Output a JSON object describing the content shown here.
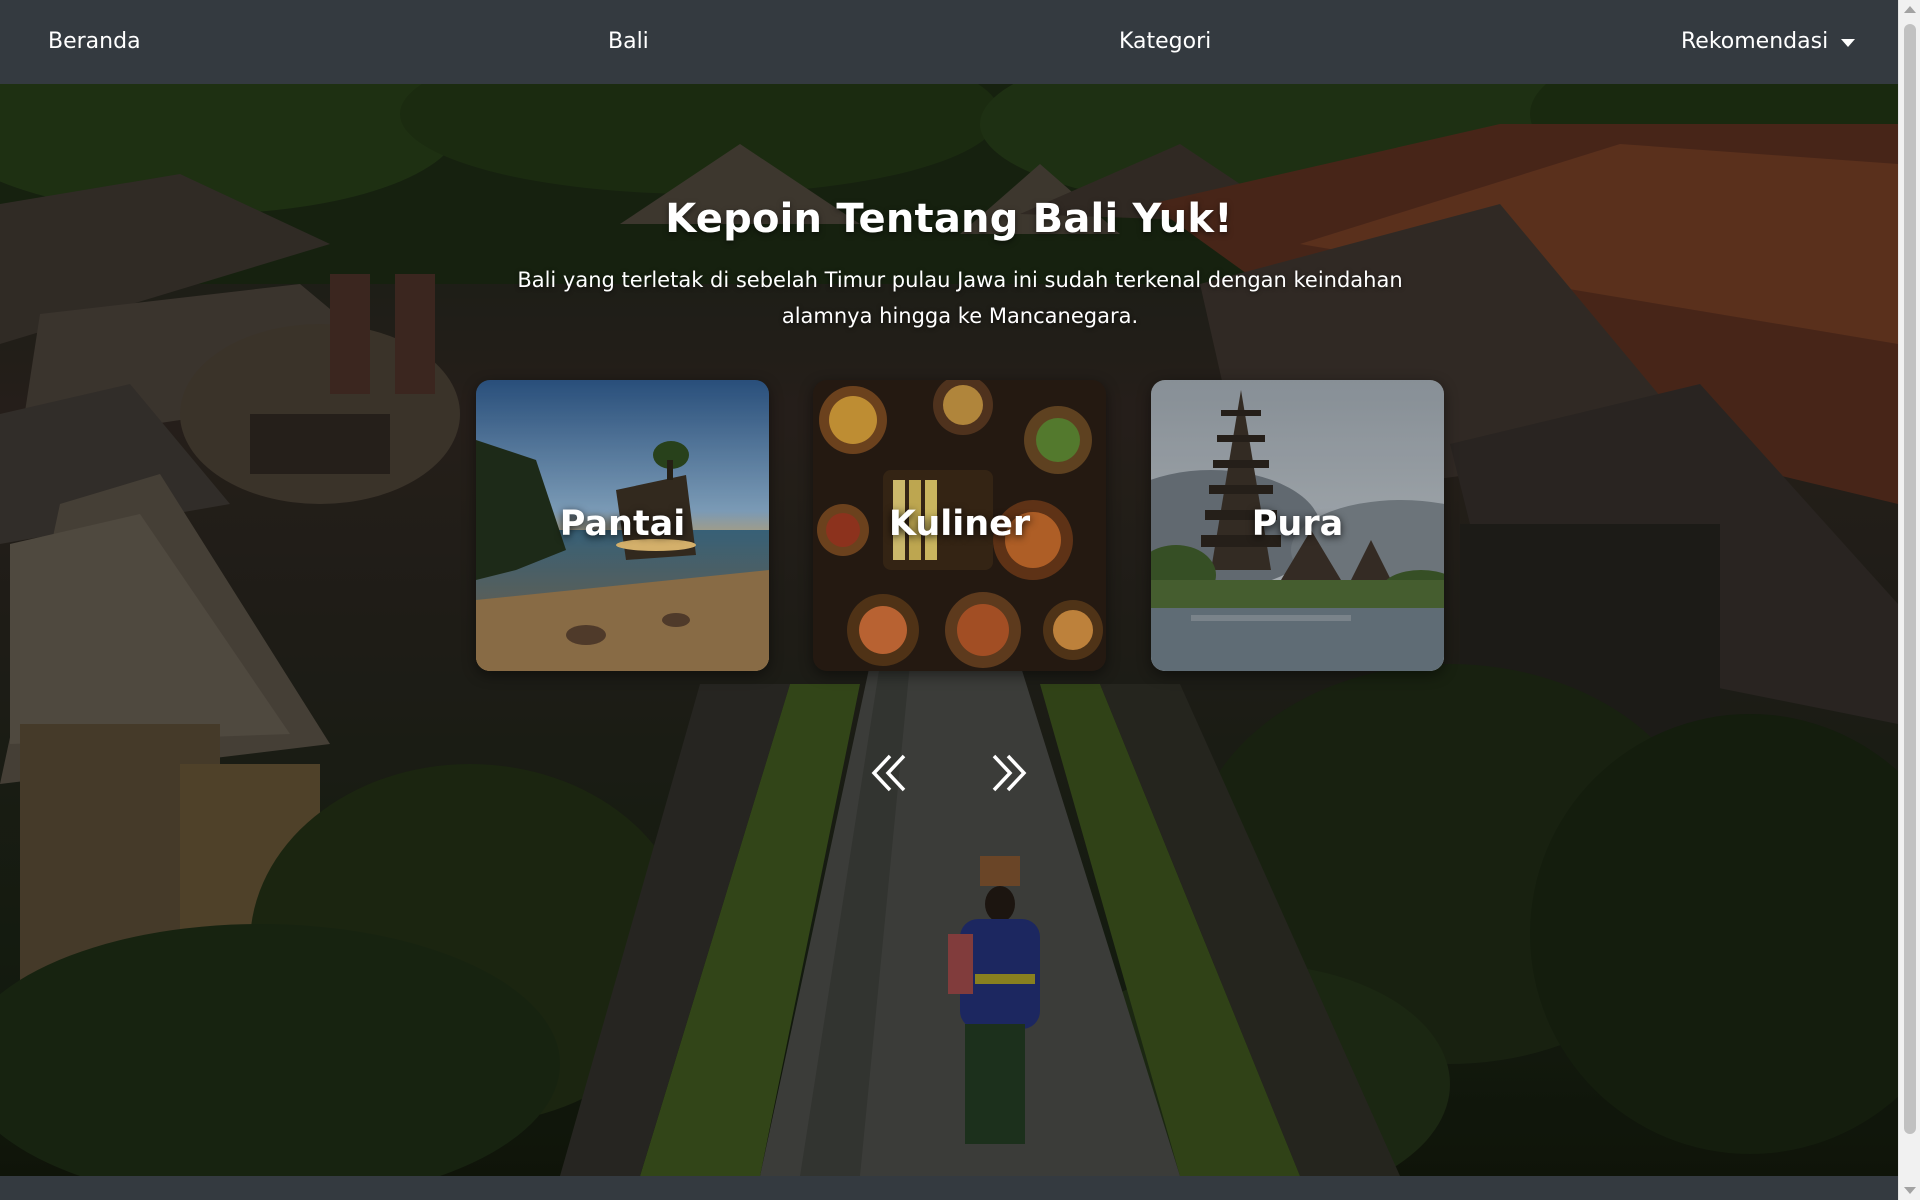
{
  "navbar": {
    "items": [
      {
        "label": "Beranda"
      },
      {
        "label": "Bali"
      },
      {
        "label": "Kategori"
      },
      {
        "label": "Rekomendasi"
      }
    ]
  },
  "hero": {
    "title": "Kepoin Tentang Bali Yuk!",
    "subtitle": "Bali yang terletak di sebelah Timur pulau Jawa ini sudah terkenal dengan keindahan alamnya hingga ke Mancanegara."
  },
  "cards": [
    {
      "label": "Pantai"
    },
    {
      "label": "Kuliner"
    },
    {
      "label": "Pura"
    }
  ],
  "carousel": {
    "prev_icon": "double-chevron-left-icon",
    "next_icon": "double-chevron-right-icon"
  },
  "colors": {
    "navbar_bg": "#343a40",
    "text": "#ffffff"
  }
}
